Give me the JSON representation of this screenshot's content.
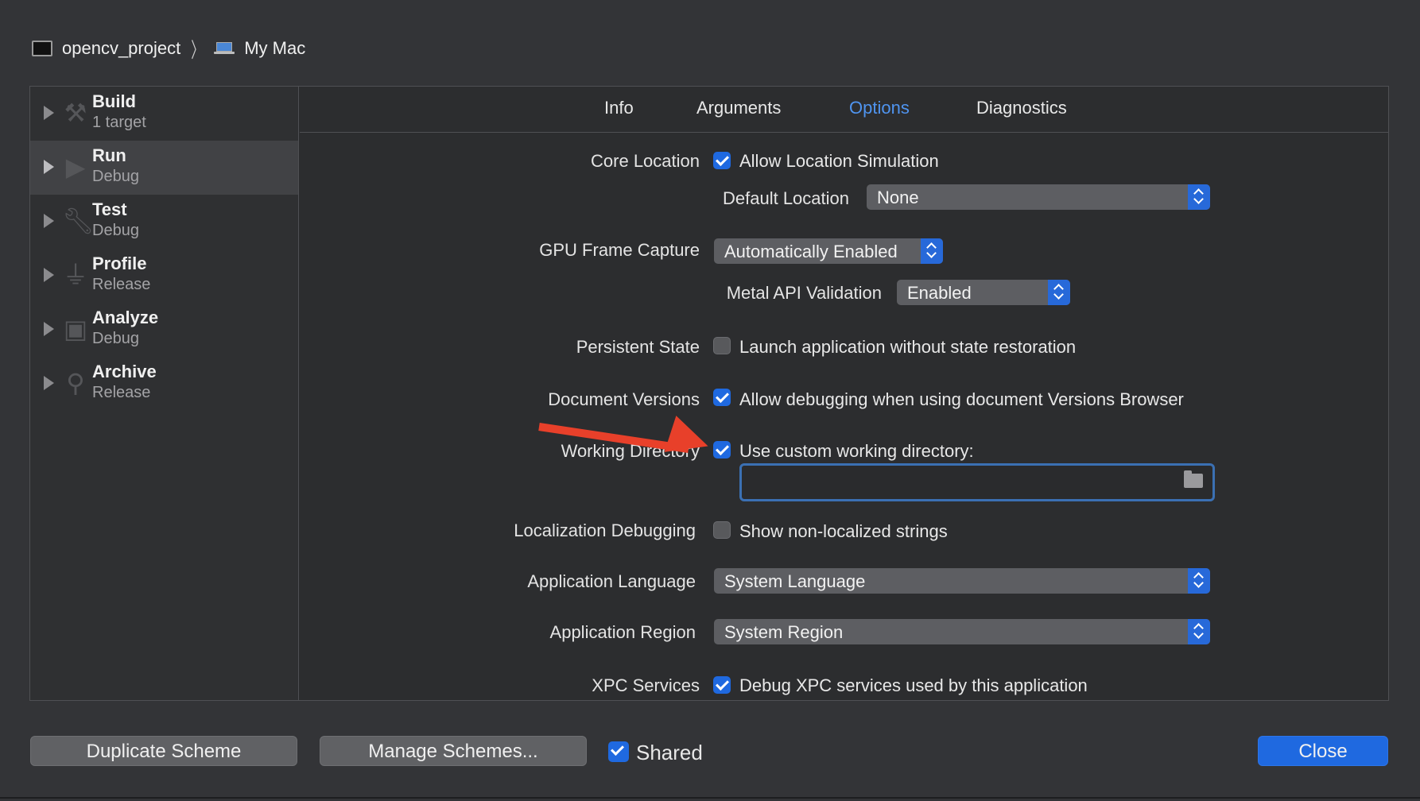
{
  "breadcrumb": {
    "project": "opencv_project",
    "destination": "My Mac"
  },
  "sidebar": {
    "items": [
      {
        "title": "Build",
        "subtitle": "1 target"
      },
      {
        "title": "Run",
        "subtitle": "Debug"
      },
      {
        "title": "Test",
        "subtitle": "Debug"
      },
      {
        "title": "Profile",
        "subtitle": "Release"
      },
      {
        "title": "Analyze",
        "subtitle": "Debug"
      },
      {
        "title": "Archive",
        "subtitle": "Release"
      }
    ],
    "selected": "Run"
  },
  "tabs": [
    "Info",
    "Arguments",
    "Options",
    "Diagnostics"
  ],
  "active_tab": "Options",
  "options": {
    "core_location": {
      "label": "Core Location",
      "checkbox": "Allow Location Simulation",
      "checked": true
    },
    "default_location": {
      "label": "Default Location",
      "value": "None"
    },
    "gpu_frame_capture": {
      "label": "GPU Frame Capture",
      "value": "Automatically Enabled"
    },
    "metal_api": {
      "label": "Metal API Validation",
      "value": "Enabled"
    },
    "persistent_state": {
      "label": "Persistent State",
      "checkbox": "Launch application without state restoration",
      "checked": false
    },
    "document_versions": {
      "label": "Document Versions",
      "checkbox": "Allow debugging when using document Versions Browser",
      "checked": true
    },
    "working_directory": {
      "label": "Working Directory",
      "checkbox": "Use custom working directory:",
      "checked": true,
      "path": ""
    },
    "localization_debugging": {
      "label": "Localization Debugging",
      "checkbox": "Show non-localized strings",
      "checked": false
    },
    "application_language": {
      "label": "Application Language",
      "value": "System Language"
    },
    "application_region": {
      "label": "Application Region",
      "value": "System Region"
    },
    "xpc_services": {
      "label": "XPC Services",
      "checkbox": "Debug XPC services used by this application",
      "checked": true
    }
  },
  "footer": {
    "duplicate": "Duplicate Scheme",
    "manage": "Manage Schemes...",
    "shared_label": "Shared",
    "shared_checked": true,
    "close": "Close"
  },
  "colors": {
    "accent": "#1f69e0",
    "active_tab": "#4f94f0",
    "annotation_arrow": "#e8402a"
  }
}
